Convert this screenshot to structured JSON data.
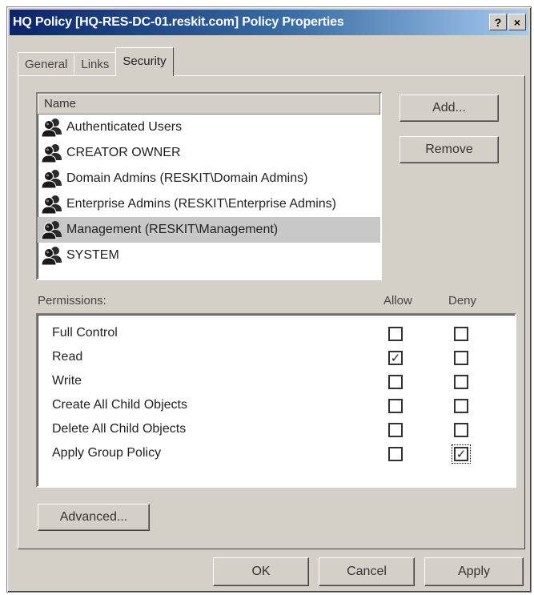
{
  "window": {
    "title": "HQ Policy [HQ-RES-DC-01.reskit.com] Policy Properties",
    "help_label": "?",
    "close_label": "×"
  },
  "tabs": [
    {
      "label": "General",
      "active": false
    },
    {
      "label": "Links",
      "active": false
    },
    {
      "label": "Security",
      "active": true
    }
  ],
  "names_list": {
    "header": "Name",
    "items": [
      {
        "label": "Authenticated Users",
        "selected": false
      },
      {
        "label": "CREATOR OWNER",
        "selected": false
      },
      {
        "label": "Domain Admins (RESKIT\\Domain Admins)",
        "selected": false
      },
      {
        "label": "Enterprise Admins (RESKIT\\Enterprise Admins)",
        "selected": false
      },
      {
        "label": "Management (RESKIT\\Management)",
        "selected": true
      },
      {
        "label": "SYSTEM",
        "selected": false
      }
    ]
  },
  "buttons": {
    "add": "Add...",
    "remove": "Remove",
    "advanced": "Advanced...",
    "ok": "OK",
    "cancel": "Cancel",
    "apply": "Apply"
  },
  "permissions": {
    "label": "Permissions:",
    "allow_header": "Allow",
    "deny_header": "Deny",
    "items": [
      {
        "label": "Full Control",
        "allow": false,
        "deny": false
      },
      {
        "label": "Read",
        "allow": true,
        "deny": false
      },
      {
        "label": "Write",
        "allow": false,
        "deny": false
      },
      {
        "label": "Create All Child Objects",
        "allow": false,
        "deny": false
      },
      {
        "label": "Delete All Child Objects",
        "allow": false,
        "deny": false
      },
      {
        "label": "Apply Group Policy",
        "allow": false,
        "deny": true
      }
    ]
  },
  "colors": {
    "title_gradient_start": "#0a246a",
    "dialog_face": "#d4d0c8",
    "selection": "#c8c8c8"
  }
}
